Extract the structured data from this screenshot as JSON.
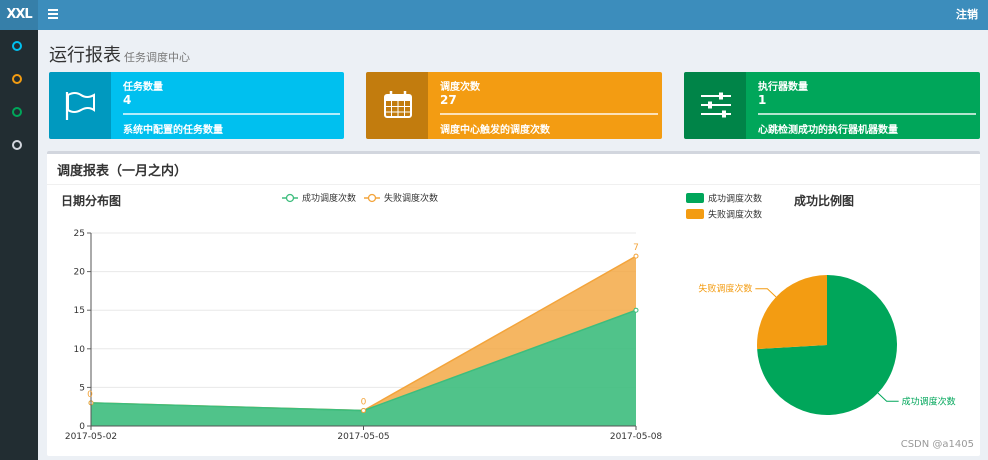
{
  "app": {
    "logo": "XXL",
    "logout_label": "注销"
  },
  "colors": {
    "topbar": "#3c8dbc",
    "sidebar": "#222d32",
    "aqua": "#00c0ef",
    "orange": "#f39c12",
    "green": "#00a65a",
    "success_series": "#3dbd7d",
    "fail_series": "#f3a43b"
  },
  "sidebar": {
    "items": [
      {
        "icon": "circle-icon",
        "color": "#00c0ef"
      },
      {
        "icon": "circle-icon",
        "color": "#f39c12"
      },
      {
        "icon": "circle-icon",
        "color": "#00a65a"
      },
      {
        "icon": "circle-icon",
        "color": "#d2d6de"
      }
    ]
  },
  "page": {
    "title": "运行报表",
    "subtitle": "任务调度中心"
  },
  "info_boxes": [
    {
      "icon": "flag-icon",
      "label": "任务数量",
      "value": "4",
      "description": "系统中配置的任务数量"
    },
    {
      "icon": "calendar-icon",
      "label": "调度次数",
      "value": "27",
      "description": "调度中心触发的调度次数"
    },
    {
      "icon": "sliders-icon",
      "label": "执行器数量",
      "value": "1",
      "description": "心跳检测成功的执行器机器数量"
    }
  ],
  "report": {
    "title": "调度报表（一月之内）"
  },
  "chart_data": [
    {
      "type": "area",
      "title": "日期分布图",
      "stacked": true,
      "x": [
        "2017-05-02",
        "2017-05-05",
        "2017-05-08"
      ],
      "series": [
        {
          "name": "成功调度次数",
          "values": [
            3,
            2,
            15
          ],
          "color": "#3dbd7d"
        },
        {
          "name": "失败调度次数",
          "values": [
            0,
            0,
            7
          ],
          "color": "#f3a43b"
        }
      ],
      "ylim": [
        0,
        25
      ],
      "yticks": [
        "0",
        "5",
        "10",
        "15",
        "20",
        "25"
      ],
      "data_labels": [
        "0",
        "0",
        "7"
      ],
      "grid": true,
      "legend": "top"
    },
    {
      "type": "pie",
      "title": "成功比例图",
      "slices": [
        {
          "name": "成功调度次数",
          "value": 20,
          "color": "#00a65a"
        },
        {
          "name": "失败调度次数",
          "value": 7,
          "color": "#f39c12"
        }
      ],
      "legend": "top-left"
    }
  ],
  "watermark": "CSDN @a1405"
}
